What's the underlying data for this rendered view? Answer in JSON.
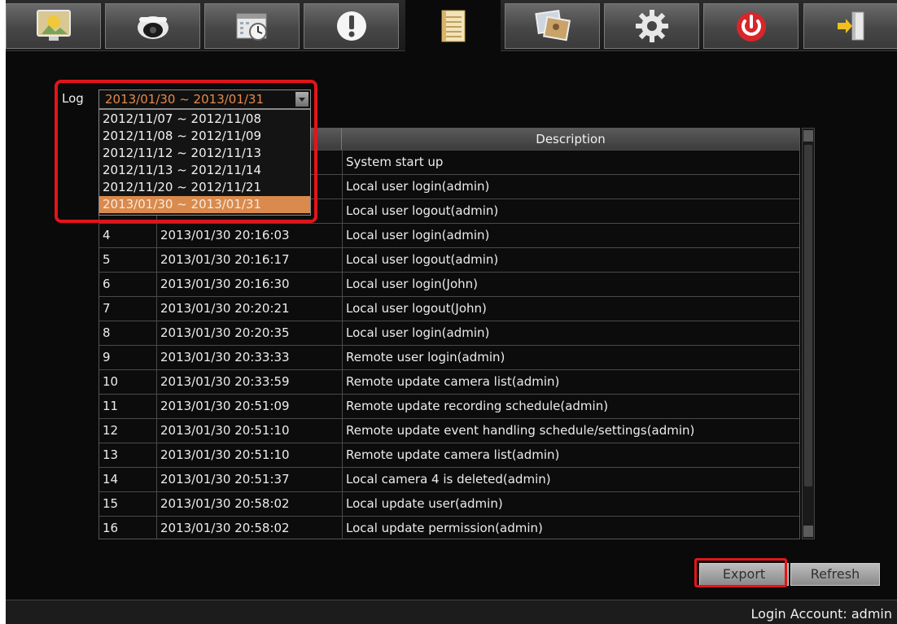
{
  "toolbar": {
    "tabs": [
      {
        "name": "live-view-tab",
        "icon": "monitor-icon"
      },
      {
        "name": "camera-tab",
        "icon": "dome-camera-icon"
      },
      {
        "name": "schedule-tab",
        "icon": "calendar-clock-icon"
      },
      {
        "name": "event-tab",
        "icon": "alert-icon"
      },
      {
        "name": "log-tab",
        "icon": "log-document-icon",
        "active": true
      },
      {
        "name": "playback-tab",
        "icon": "photos-icon"
      },
      {
        "name": "settings-tab",
        "icon": "gear-icon"
      },
      {
        "name": "power-tab",
        "icon": "power-icon"
      },
      {
        "name": "logout-tab",
        "icon": "exit-door-icon"
      }
    ]
  },
  "log": {
    "label": "Log",
    "selected": "2013/01/30 ~ 2013/01/31",
    "options": [
      "2012/11/07 ~ 2012/11/08",
      "2012/11/08 ~ 2012/11/09",
      "2012/11/12 ~ 2012/11/13",
      "2012/11/13 ~ 2012/11/14",
      "2012/11/20 ~ 2012/11/21",
      "2013/01/30 ~ 2013/01/31"
    ]
  },
  "table": {
    "headers": [
      "",
      "",
      "Description"
    ],
    "rows": [
      {
        "no": "",
        "time": "",
        "desc": "System start up"
      },
      {
        "no": "",
        "time": "",
        "desc": "Local user login(admin)"
      },
      {
        "no": "",
        "time": "",
        "desc": "Local user logout(admin)"
      },
      {
        "no": "4",
        "time": "2013/01/30 20:16:03",
        "desc": "Local user login(admin)"
      },
      {
        "no": "5",
        "time": "2013/01/30 20:16:17",
        "desc": "Local user logout(admin)"
      },
      {
        "no": "6",
        "time": "2013/01/30 20:16:30",
        "desc": "Local user login(John)"
      },
      {
        "no": "7",
        "time": "2013/01/30 20:20:21",
        "desc": "Local user logout(John)"
      },
      {
        "no": "8",
        "time": "2013/01/30 20:20:35",
        "desc": "Local user login(admin)"
      },
      {
        "no": "9",
        "time": "2013/01/30 20:33:33",
        "desc": "Remote user login(admin)"
      },
      {
        "no": "10",
        "time": "2013/01/30 20:33:59",
        "desc": "Remote update camera list(admin)"
      },
      {
        "no": "11",
        "time": "2013/01/30 20:51:09",
        "desc": "Remote update recording schedule(admin)"
      },
      {
        "no": "12",
        "time": "2013/01/30 20:51:10",
        "desc": "Remote update event handling schedule/settings(admin)"
      },
      {
        "no": "13",
        "time": "2013/01/30 20:51:10",
        "desc": "Remote update camera list(admin)"
      },
      {
        "no": "14",
        "time": "2013/01/30 20:51:37",
        "desc": "Local camera 4 is deleted(admin)"
      },
      {
        "no": "15",
        "time": "2013/01/30 20:58:02",
        "desc": "Local update user(admin)"
      },
      {
        "no": "16",
        "time": "2013/01/30 20:58:02",
        "desc": "Local update permission(admin)"
      }
    ]
  },
  "buttons": {
    "export": "Export",
    "refresh": "Refresh"
  },
  "footer": {
    "login_account": "Login Account:  admin"
  },
  "colors": {
    "highlight": "#e3141a",
    "selected_option": "#d98a4c",
    "selected_text": "#e7894a"
  }
}
